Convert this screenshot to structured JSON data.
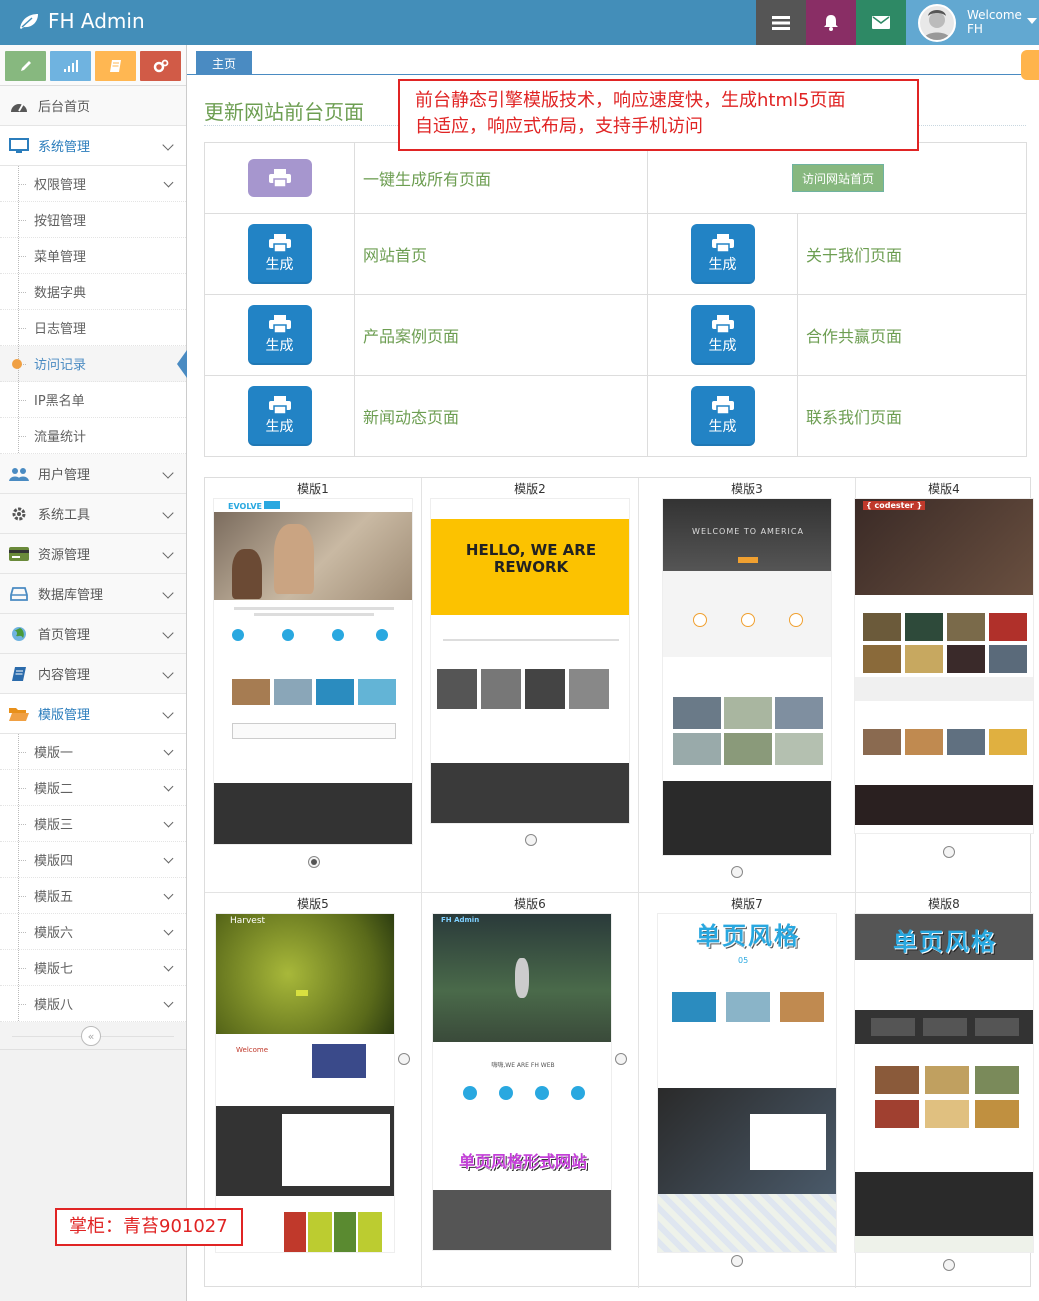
{
  "navbar": {
    "brand": "FH Admin",
    "welcome": "Welcome",
    "username": "FH"
  },
  "sidebar": {
    "items": [
      {
        "label": "后台首页"
      },
      {
        "label": "系统管理",
        "sub": [
          "权限管理",
          "按钮管理",
          "菜单管理",
          "数据字典",
          "日志管理",
          "访问记录",
          "IP黑名单",
          "流量统计"
        ]
      },
      {
        "label": "用户管理"
      },
      {
        "label": "系统工具"
      },
      {
        "label": "资源管理"
      },
      {
        "label": "数据库管理"
      },
      {
        "label": "首页管理"
      },
      {
        "label": "内容管理"
      },
      {
        "label": "模版管理",
        "sub": [
          "模版一",
          "模版二",
          "模版三",
          "模版四",
          "模版五",
          "模版六",
          "模版七",
          "模版八"
        ]
      }
    ],
    "active_sub": "访问记录"
  },
  "breadcrumb": {
    "home": "主页"
  },
  "page": {
    "title": "更新网站前台页面"
  },
  "notice": {
    "line1": "前台静态引擎模版技术，响应速度快，生成html5页面",
    "line2": "自适应，响应式布局，支持手机访问"
  },
  "generator": {
    "gen_all_label": "一键生成所有页面",
    "visit_home": "访问网站首页",
    "gen_button": "生成",
    "pages": [
      "网站首页",
      "关于我们页面",
      "产品案例页面",
      "合作共赢页面",
      "新闻动态页面",
      "联系我们页面"
    ]
  },
  "templates": [
    {
      "name": "模版1",
      "selected": true,
      "headline": "EVOLVE"
    },
    {
      "name": "模版2",
      "selected": false,
      "headline": "HELLO, WE ARE REWORK"
    },
    {
      "name": "模版3",
      "selected": false,
      "headline": "WELCOME TO AMERICA"
    },
    {
      "name": "模版4",
      "selected": false,
      "headline": "{ codester }"
    },
    {
      "name": "模版5",
      "selected": false,
      "headline": "Harvest"
    },
    {
      "name": "模版6",
      "selected": false,
      "headline": "FH Admin"
    },
    {
      "name": "模版7",
      "selected": false,
      "headline": "单页风格"
    },
    {
      "name": "模版8",
      "selected": false,
      "headline": "单页风格"
    }
  ],
  "template_overlays": {
    "t6_caption": "单页风格形式网站"
  },
  "owner": "掌柜：青苔901027",
  "colors": {
    "navbar": "#438eb9",
    "accent_blue": "#2283c5",
    "accent_green": "#87b87f",
    "notice_red": "#e02424"
  }
}
